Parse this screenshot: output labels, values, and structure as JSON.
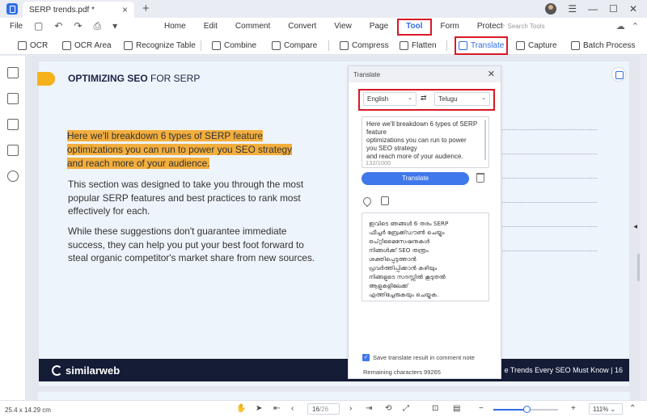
{
  "titlebar": {
    "tab_title": "SERP trends.pdf *",
    "tab_close": "×",
    "new_tab": "+",
    "minimize": "—",
    "maximize": "☐",
    "close": "✕"
  },
  "menubar": {
    "file": "File",
    "items": [
      "Home",
      "Edit",
      "Comment",
      "Convert",
      "View",
      "Page",
      "Tool",
      "Form",
      "Protect"
    ],
    "active_item": "Tool",
    "search_placeholder": "Search Tools"
  },
  "toolbar": {
    "ocr": "OCR",
    "ocr_area": "OCR Area",
    "recognize_table": "Recognize Table",
    "combine": "Combine",
    "compare": "Compare",
    "compress": "Compress",
    "flatten": "Flatten",
    "translate": "Translate",
    "capture": "Capture",
    "batch_process": "Batch Process"
  },
  "document": {
    "heading_bold": "OPTIMIZING SEO",
    "heading_rest": " FOR SERP",
    "highlighted_lines": [
      "Here we'll breakdown 6 types of SERP feature",
      "optimizations you can run to power you SEO strategy",
      "and reach more of your audience."
    ],
    "paragraph_1": "This section was designed to take you through the most popular SERP features and best practices to rank most effectively for each.",
    "paragraph_2": "While these suggestions don't guarantee immediate success, they can help you put your best foot forward to steal organic competitor's market share from new sources.",
    "footer_brand": "similarweb",
    "footer_text": "e Trends Every SEO Must Know  |  16"
  },
  "translate_panel": {
    "title": "Translate",
    "source_language": "English",
    "target_language": "Telugu",
    "source_text": "Here we'll breakdown 6 types of SERP\nfeature\noptimizations you can run to power\nyou SEO strategy\nand reach more of your audience.",
    "char_count": "132/1000",
    "translate_button": "Translate",
    "output_text": "ഇവിടെ ഞങ്ങൾ 6 തരം SERP\nഫീച്ചർ ബ്രേക്ക്ഡൗൺ ചെയ്യും\nഒപ്റ്റിമൈസേഷനുകൾ\nനിങ്ങൾക്ക് SEO തന്ത്രം\nശക്തിപ്പെടുത്താൻ\nപ്രവർത്തിപ്പിക്കാൻ കഴിയും\nനിങ്ങളുടെ സദസ്സിൽ കൂടുതൽ\nആളുകളിലേക്ക്\nഎത്തിച്ചേരുകയും ചെയ്യുക.",
    "save_option": "Save translate result in comment note",
    "save_checked": true,
    "remaining": "Remaining characters 99265"
  },
  "statusbar": {
    "dimensions": "25.4 x 14.29 cm",
    "current_page": "16",
    "total_pages": "/26",
    "zoom_level": "111%",
    "zoom_fraction": 0.52
  },
  "colors": {
    "accent": "#2f6ee6",
    "highlight": "#f3ae3d",
    "annotation_box": "#d71928",
    "footer_bg": "#141c36"
  }
}
